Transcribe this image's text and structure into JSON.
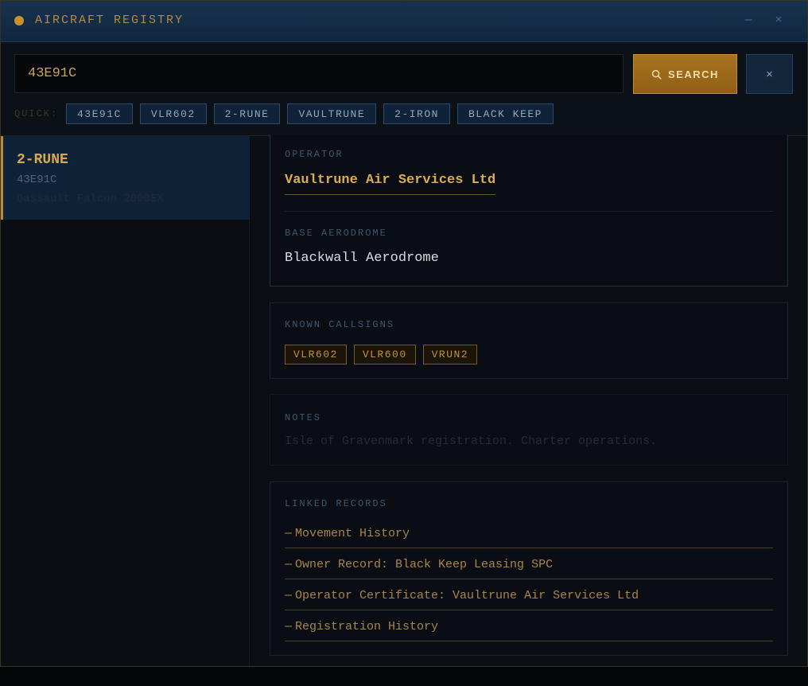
{
  "window": {
    "title": "AIRCRAFT REGISTRY",
    "minimize_label": "—",
    "close_label": "×"
  },
  "search": {
    "value": "43E91C",
    "placeholder": "",
    "button_label": "SEARCH",
    "clear_label": "×",
    "quick_label": "QUICK:",
    "quick_chips": [
      "43E91C",
      "VLR602",
      "2-RUNE",
      "VAULTRUNE",
      "2-IRON",
      "BLACK KEEP"
    ]
  },
  "results": [
    {
      "registration": "2-RUNE",
      "hex": "43E91C",
      "type": "Dassault Falcon 2000EX"
    }
  ],
  "detail": {
    "operator_label": "OPERATOR",
    "operator_value": "Vaultrune Air Services Ltd",
    "base_label": "BASE AERODROME",
    "base_value": "Blackwall Aerodrome",
    "callsigns_label": "KNOWN CALLSIGNS",
    "callsigns": [
      "VLR602",
      "VLR600",
      "VRUN2"
    ],
    "notes_label": "NOTES",
    "notes_value": "Isle of Gravenmark registration. Charter operations.",
    "linked_label": "LINKED RECORDS",
    "linked_dash": "—",
    "linked_records": [
      "Movement History",
      "Owner Record: Black Keep Leasing SPC",
      "Operator Certificate: Vaultrune Air Services Ltd",
      "Registration History"
    ]
  },
  "colors": {
    "accent": "#c9922f",
    "titlebar": "#17324e",
    "background": "#0a0d12"
  },
  "icons": {
    "title_dot": "status-dot-icon",
    "search_button": "search-icon",
    "clear_button": "close-icon"
  }
}
